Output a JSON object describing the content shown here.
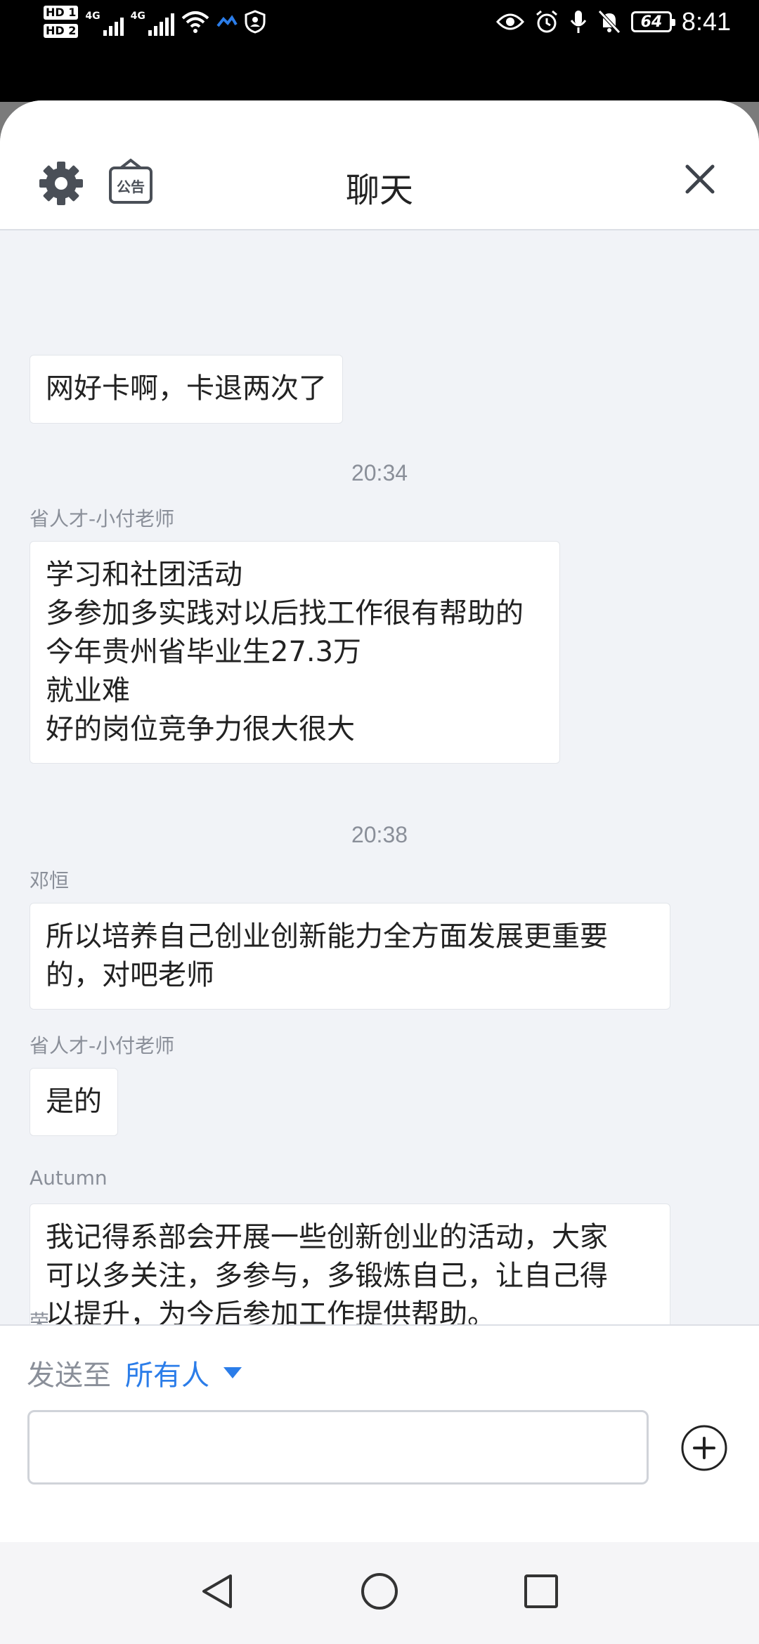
{
  "status_bar": {
    "sim1": "HD 1",
    "sim2": "HD 2",
    "net1": "4G",
    "net2": "4G",
    "battery": "64",
    "time": "8:41"
  },
  "header": {
    "title": "聊天",
    "notice_label": "公告"
  },
  "messages": [
    {
      "sender": "",
      "text": "网好卡啊，卡退两次了"
    },
    {
      "time": "20:34"
    },
    {
      "sender": "省人才-小付老师",
      "text": "学习和社团活动\n多参加多实践对以后找工作很有帮助的\n今年贵州省毕业生27.3万\n就业难\n好的岗位竞争力很大很大"
    },
    {
      "time": "20:38"
    },
    {
      "sender": "邓恒",
      "text": "所以培养自己创业创新能力全方面发展更重要\n的，对吧老师"
    },
    {
      "sender": "省人才-小付老师",
      "text": "是的"
    },
    {
      "sender": "Autumn",
      "text": "我记得系部会开展一些创新创业的活动，大家\n可以多关注，多参与，多锻炼自己，让自己得\n以提升，为今后参加工作提供帮助。"
    },
    {
      "sender": "荣"
    }
  ],
  "composer": {
    "send_to_label": "发送至",
    "send_to_target": "所有人",
    "input_value": "",
    "input_placeholder": ""
  },
  "icons": {
    "settings": "gear-icon",
    "notice": "notice-icon",
    "close": "close-icon",
    "add": "plus-circle-icon",
    "nav_back": "triangle-back-icon",
    "nav_home": "circle-home-icon",
    "nav_recent": "square-recent-icon"
  },
  "colors": {
    "accent": "#2b7de9",
    "background": "#f1f3f7"
  }
}
